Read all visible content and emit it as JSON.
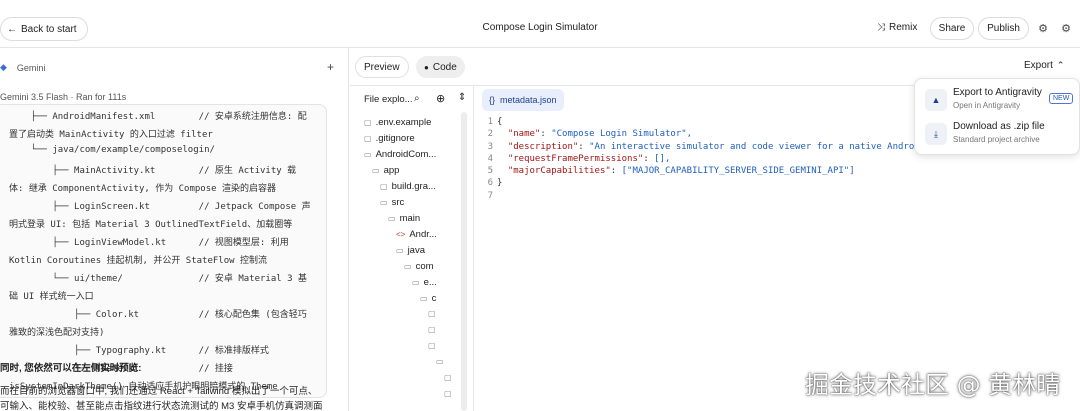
{
  "header": {
    "back_label": "Back to start",
    "title": "Compose Login Simulator",
    "remix_label": "Remix",
    "share_label": "Share",
    "publish_label": "Publish"
  },
  "chat": {
    "source_label": "Gemini",
    "model_meta": "Gemini 3.5 Flash  ·  Ran for 111s",
    "code_lines": [
      "    ├── AndroidManifest.xml        // 安卓系统注册信息: 配",
      "置了启动类 MainActivity 的入口过滤 filter",
      "    └── java/com/example/composelogin/",
      "        ├── MainActivity.kt        // 原生 Activity 载",
      "体: 继承 ComponentActivity, 作为 Compose 渲染的启容器",
      "        ├── LoginScreen.kt         // Jetpack Compose 声",
      "明式登录 UI: 包括 Material 3 OutlinedTextField、加载圈等",
      "        ├── LoginViewModel.kt      // 视图模型层: 利用",
      "Kotlin Coroutines 挂起机制, 并公开 StateFlow 控制流",
      "        └── ui/theme/              // 安卓 Material 3 基",
      "础 UI 样式统一入口",
      "            ├── Color.kt           // 核心配色集 (包含轻巧",
      "雅致的深浅色配对支持)",
      "            ├── Typography.kt      // 标准排版样式",
      "            └── Theme.kt           // 挂接",
      "isSystemInDarkTheme() 自动适应手机护眼明暗模式的 Theme"
    ],
    "para1": "同时, 您依然可以在左侧实时预览:",
    "para2_a": "而在目前的浏览器窗口中, 我们还通过 React + Tailwind 模拟出了一个可点、",
    "para2_b": "可输入、能校验、甚至能点击指纹进行状态流测试的 M3 安卓手机仿真调测面"
  },
  "view_tabs": {
    "preview": "Preview",
    "code": "Code"
  },
  "explorer": {
    "title": "File explo...",
    "items": [
      {
        "label": ".env.example",
        "kind": "file"
      },
      {
        "label": ".gitignore",
        "kind": "file"
      },
      {
        "label": "AndroidCom...",
        "kind": "folder"
      },
      {
        "label": "app",
        "kind": "folder"
      },
      {
        "label": "build.gra...",
        "kind": "file"
      },
      {
        "label": "src",
        "kind": "folder"
      },
      {
        "label": "main",
        "kind": "folder"
      },
      {
        "label": "Andr...",
        "kind": "xml"
      },
      {
        "label": "java",
        "kind": "folder"
      },
      {
        "label": "com",
        "kind": "folder"
      },
      {
        "label": "e...",
        "kind": "folder"
      },
      {
        "label": "c",
        "kind": "folder"
      },
      {
        "label": "",
        "kind": "file"
      },
      {
        "label": "",
        "kind": "file"
      },
      {
        "label": "",
        "kind": "file"
      },
      {
        "label": "",
        "kind": "folder"
      },
      {
        "label": "",
        "kind": "file"
      },
      {
        "label": "",
        "kind": "file"
      }
    ]
  },
  "editor": {
    "file_tab": "metadata.json",
    "lines": [
      {
        "n": "1",
        "t": "{"
      },
      {
        "n": "2",
        "k": "\"name\"",
        "v": "\"Compose Login Simulator\","
      },
      {
        "n": "3",
        "k": "\"description\"",
        "v": "\"An interactive simulator and code viewer for a native Android login s"
      },
      {
        "n": "4",
        "k": "\"requestFramePermissions\"",
        "v": "[],"
      },
      {
        "n": "5",
        "k": "\"majorCapabilities\"",
        "v": "[\"MAJOR_CAPABILITY_SERVER_SIDE_GEMINI_API\"]"
      },
      {
        "n": "6",
        "t": "}"
      },
      {
        "n": "7",
        "t": ""
      }
    ]
  },
  "export": {
    "button_label": "Export",
    "items": [
      {
        "title": "Export to Antigravity",
        "subtitle": "Open in Antigravity",
        "badge": "NEW"
      },
      {
        "title": "Download as .zip file",
        "subtitle": "Standard project archive"
      }
    ]
  },
  "watermark": "掘金技术社区 @ 黄林晴"
}
